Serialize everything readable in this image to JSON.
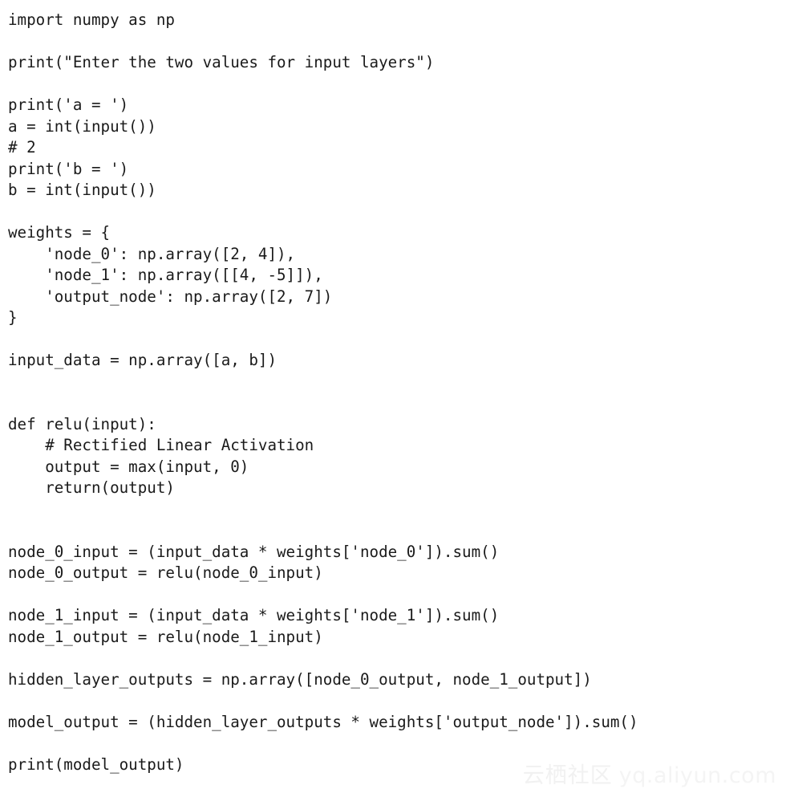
{
  "document": {
    "kind": "code-listing",
    "language": "python",
    "background_color": "#ffffff",
    "text_color": "#1a1a1a"
  },
  "code": {
    "lines": [
      "import numpy as np",
      "",
      "print(\"Enter the two values for input layers\")",
      "",
      "print('a = ')",
      "a = int(input())",
      "# 2",
      "print('b = ')",
      "b = int(input())",
      "",
      "weights = {",
      "    'node_0': np.array([2, 4]),",
      "    'node_1': np.array([[4, -5]]),",
      "    'output_node': np.array([2, 7])",
      "}",
      "",
      "input_data = np.array([a, b])",
      "",
      "",
      "def relu(input):",
      "    # Rectified Linear Activation",
      "    output = max(input, 0)",
      "    return(output)",
      "",
      "",
      "node_0_input = (input_data * weights['node_0']).sum()",
      "node_0_output = relu(node_0_input)",
      "",
      "node_1_input = (input_data * weights['node_1']).sum()",
      "node_1_output = relu(node_1_input)",
      "",
      "hidden_layer_outputs = np.array([node_0_output, node_1_output])",
      "",
      "model_output = (hidden_layer_outputs * weights['output_node']).sum()",
      "",
      "print(model_output)"
    ]
  },
  "watermark": {
    "brand_cn": "云栖社区",
    "url": "yq.aliyun.com",
    "color": "#f2f2f2"
  }
}
